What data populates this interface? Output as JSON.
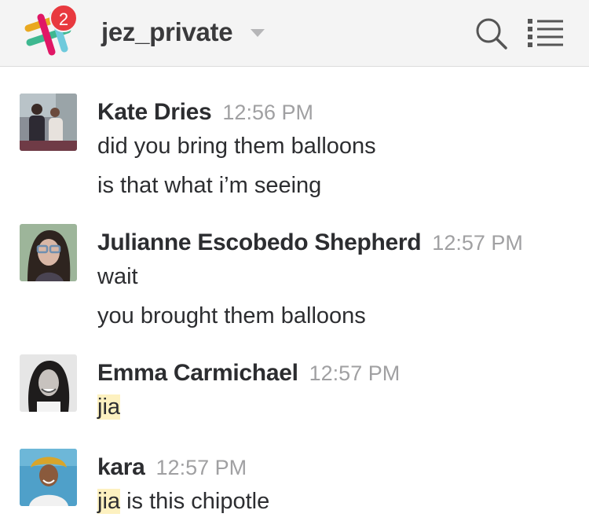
{
  "header": {
    "channel_name": "jez_private",
    "badge_count": "2",
    "icons": {
      "logo": "slack-logo-icon",
      "dropdown": "caret-down-icon",
      "search": "search-icon",
      "menu": "list-menu-icon"
    },
    "colors": {
      "badge": "#e8393f",
      "background": "#f4f4f4"
    }
  },
  "messages": [
    {
      "author": "Kate Dries",
      "time": "12:56 PM",
      "lines": [
        "did you bring them balloons",
        "is that what i’m seeing"
      ]
    },
    {
      "author": "Julianne Escobedo Shepherd",
      "time": "12:57 PM",
      "lines": [
        "wait",
        "you brought them balloons"
      ]
    },
    {
      "author": "Emma Carmichael",
      "time": "12:57 PM",
      "lines": [
        "jia"
      ],
      "mention": "jia"
    },
    {
      "author": "kara",
      "time": "12:57 PM",
      "mention": "jia",
      "rest": " is this chipotle"
    }
  ],
  "colors": {
    "mention_highlight": "#fdf1c0",
    "timestamp": "#a0a0a2"
  }
}
